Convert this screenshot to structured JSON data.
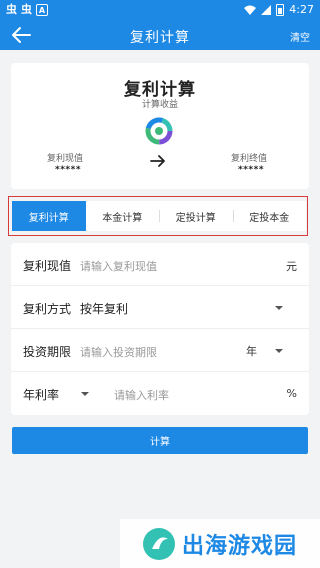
{
  "status_bar": {
    "left_glyphs": [
      "虫",
      "虫"
    ],
    "badge": "A",
    "time": "4:27"
  },
  "app_bar": {
    "title": "复利计算",
    "clear_label": "清空",
    "back_icon": "arrow-left-icon"
  },
  "summary": {
    "title": "复利计算",
    "subtitle": "计算收益",
    "logo_icon": "donut-logo-icon",
    "present_value_label": "复利现值",
    "present_value": "*****",
    "future_value_label": "复利终值",
    "future_value": "*****",
    "arrow_icon": "arrow-right-icon"
  },
  "tabs": [
    {
      "label": "复利计算",
      "active": true
    },
    {
      "label": "本金计算",
      "active": false
    },
    {
      "label": "定投计算",
      "active": false
    },
    {
      "label": "定投本金",
      "active": false
    }
  ],
  "form": {
    "present_value": {
      "label": "复利现值",
      "placeholder": "请输入复利现值",
      "unit": "元"
    },
    "method": {
      "label": "复利方式",
      "value": "按年复利"
    },
    "period": {
      "label": "投资期限",
      "placeholder": "请输入投资期限",
      "unit": "年"
    },
    "rate": {
      "label": "年利率",
      "placeholder": "请输入利率",
      "unit": "%"
    }
  },
  "calculate_label": "计算",
  "watermark": {
    "text": "出海游戏园"
  },
  "colors": {
    "primary": "#1e88e5",
    "highlight_border": "#d63a3a",
    "background": "#f2f3f5"
  }
}
